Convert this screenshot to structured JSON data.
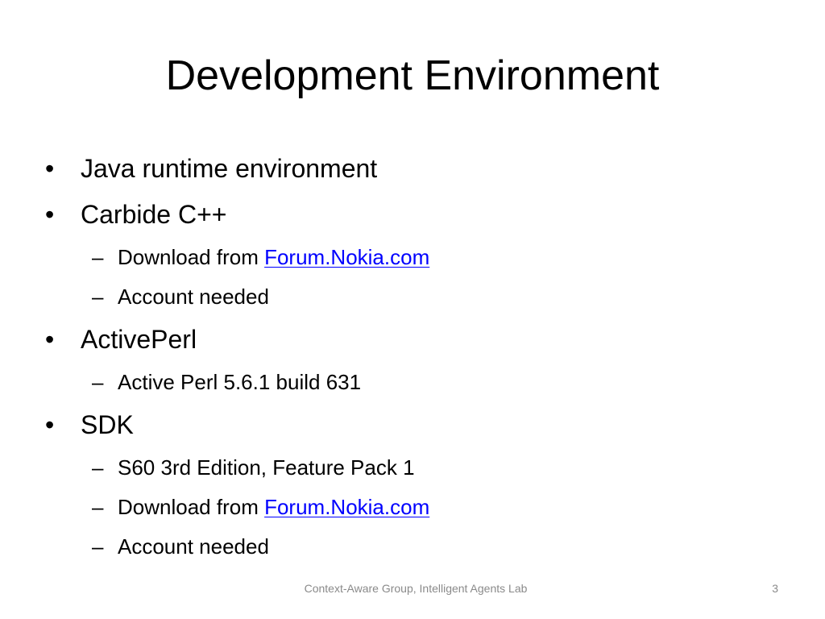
{
  "slide": {
    "title": "Development Environment",
    "footer": "Context-Aware Group, Intelligent Agents Lab",
    "page_number": "3",
    "bullet_glyph": "•",
    "dash_glyph": "–",
    "link_color": "#0000ff",
    "footer_color": "#8a8a8a"
  },
  "bullets": [
    {
      "text": "Java runtime environment"
    },
    {
      "text": "Carbide C++",
      "sub": [
        {
          "prefix": "Download from ",
          "link": "Forum.Nokia.com"
        },
        {
          "text": "Account needed"
        }
      ]
    },
    {
      "text": "ActivePerl",
      "sub": [
        {
          "text": "Active Perl 5.6.1 build 631"
        }
      ]
    },
    {
      "text": "SDK",
      "sub": [
        {
          "text": "S60 3rd Edition, Feature Pack 1"
        },
        {
          "prefix": "Download from ",
          "link": "Forum.Nokia.com"
        },
        {
          "text": "Account needed"
        }
      ]
    }
  ]
}
